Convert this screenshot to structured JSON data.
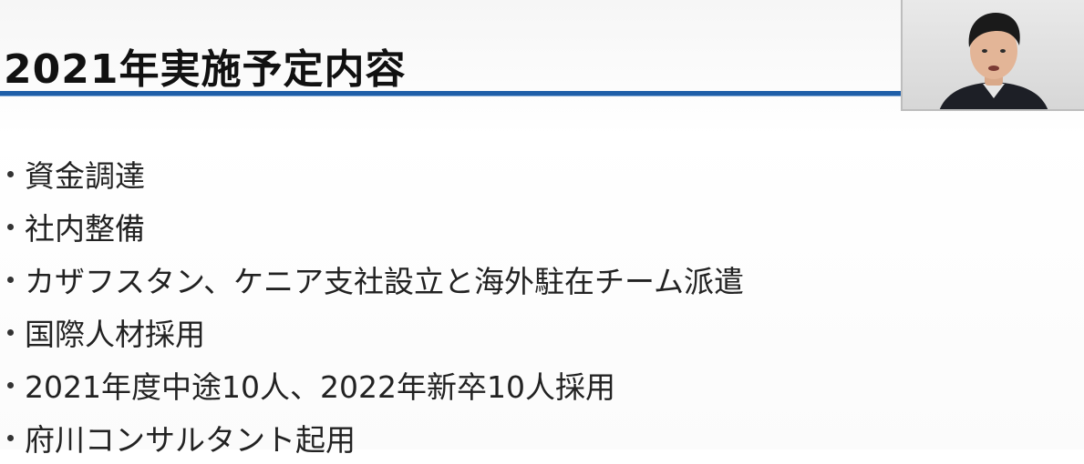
{
  "slide": {
    "title": "2021年実施予定内容",
    "bullets": [
      "資金調達",
      "社内整備",
      "カザフスタン、ケニア支社設立と海外駐在チーム派遣",
      "国際人材採用",
      "2021年度中途10人、2022年新卒10人採用",
      "府川コンサルタント起用"
    ]
  },
  "colors": {
    "accent_rule": "#1f5fa8",
    "text": "#222222"
  },
  "participant": {
    "icon": "presenter-video-icon"
  }
}
